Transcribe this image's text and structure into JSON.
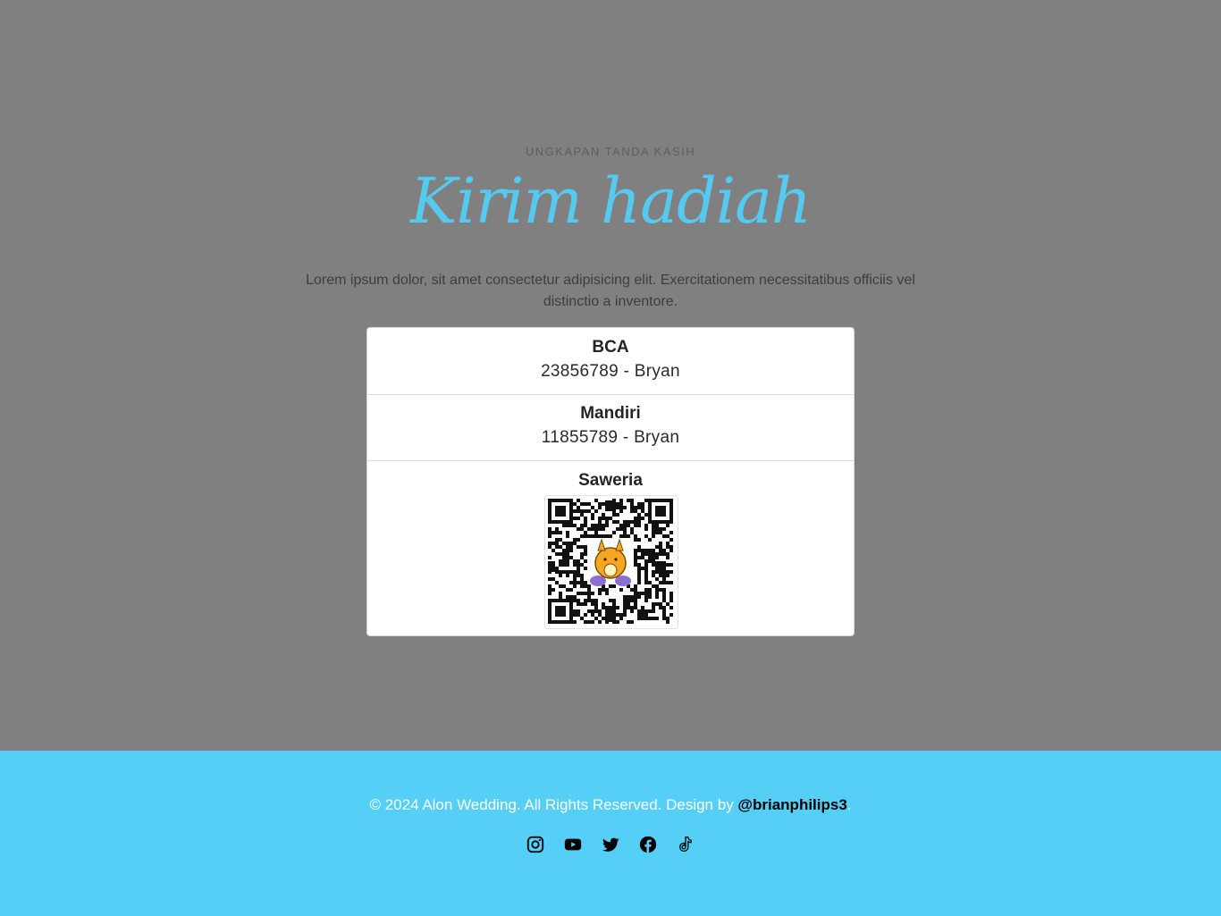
{
  "gift": {
    "eyebrow": "UNGKAPAN TANDA KASIH",
    "title": "Kirim hadiah",
    "description": "Lorem ipsum dolor, sit amet consectetur adipisicing elit. Exercitationem necessitatibus officiis vel distinctio a inventore.",
    "accounts": [
      {
        "bank": "BCA",
        "number": "23856789 - Bryan"
      },
      {
        "bank": "Mandiri",
        "number": "11855789 - Bryan"
      },
      {
        "bank": "Saweria",
        "qr_icon": "qr-code-icon"
      }
    ]
  },
  "footer": {
    "copyright": "© 2024 Alon Wedding. All Rights Reserved. Design by ",
    "designer": "@brianphilips3",
    "period": ".",
    "socials": [
      "instagram-icon",
      "youtube-icon",
      "twitter-icon",
      "facebook-icon",
      "tiktok-icon"
    ]
  },
  "colors": {
    "background": "#808080",
    "accent": "#56c9f0",
    "footer": "#56cff7"
  }
}
